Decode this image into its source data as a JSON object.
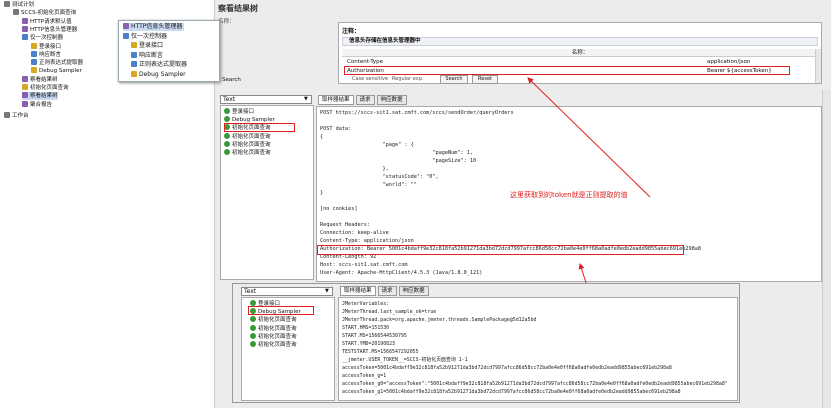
{
  "tree": {
    "items": [
      {
        "label": "测试计划",
        "indent": 0,
        "icon": "flask-icon",
        "color": "k"
      },
      {
        "label": "SCCS-初始化页面查询",
        "indent": 1,
        "icon": "gear-icon",
        "color": "k"
      },
      {
        "label": "HTTP请求默认值",
        "indent": 2,
        "icon": "wrench-icon",
        "color": "p"
      },
      {
        "label": "HTTP信息头管理器",
        "indent": 2,
        "icon": "wrench-icon",
        "color": "p"
      },
      {
        "label": "仅一次控制器",
        "indent": 2,
        "icon": "controller-icon",
        "color": "b"
      },
      {
        "label": "登录接口",
        "indent": 3,
        "icon": "pencil-icon",
        "color": "y"
      },
      {
        "label": "响应断言",
        "indent": 3,
        "icon": "magnifier-icon",
        "color": "b"
      },
      {
        "label": "正则表达式提取器",
        "indent": 3,
        "icon": "extractor-icon",
        "color": "b"
      },
      {
        "label": "Debug Sampler",
        "indent": 3,
        "icon": "pencil-icon",
        "color": "y"
      },
      {
        "label": "察看结果树",
        "indent": 2,
        "icon": "chart-icon",
        "color": "p"
      },
      {
        "label": "初始化页面查询",
        "indent": 2,
        "icon": "pencil-icon",
        "color": "y"
      },
      {
        "label": "察看结果树",
        "indent": 2,
        "icon": "chart-icon",
        "color": "p",
        "selected": true
      },
      {
        "label": "聚合报告",
        "indent": 2,
        "icon": "chart-icon",
        "color": "p"
      },
      {
        "label": "工作台",
        "indent": 0,
        "icon": "workbench-icon",
        "color": "k"
      }
    ]
  },
  "popup": {
    "items": [
      {
        "label": "HTTP信息头管理器",
        "indent": 0,
        "color": "p",
        "selected": true
      },
      {
        "label": "仅一次控制器",
        "indent": 0,
        "color": "b"
      },
      {
        "label": "登录接口",
        "indent": 1,
        "color": "y"
      },
      {
        "label": "响应断言",
        "indent": 1,
        "color": "b"
      },
      {
        "label": "正则表达式提取器",
        "indent": 1,
        "color": "b"
      },
      {
        "label": "Debug Sampler",
        "indent": 1,
        "color": "y"
      }
    ]
  },
  "main": {
    "title": "察看结果树",
    "tab_stub": "名称：",
    "comment_label": "注释：",
    "header_panel_title": "信息头存储在信息头管理器中",
    "table_header": "名称：",
    "headers": [
      {
        "name": "Content-Type",
        "value": "application/json"
      },
      {
        "name": "Authorization",
        "value": "Bearer ${accessToken}"
      }
    ],
    "search_label": "Search",
    "case_sensitive": "Case sensitive",
    "regex_label": "Regular exp.",
    "search_button": "Search",
    "reset_button": "Reset"
  },
  "top_result": {
    "renderer": "Text",
    "tabs": [
      "取样器结果",
      "请求",
      "响应数据"
    ],
    "samples": [
      {
        "label": "登录接口"
      },
      {
        "label": "Debug Sampler"
      },
      {
        "label": "初始化页面查询",
        "boxed": true
      },
      {
        "label": "初始化页面查询"
      },
      {
        "label": "初始化页面查询"
      },
      {
        "label": "初始化页面查询"
      }
    ],
    "request_text": "POST https://sccs-sit1.sat.cmft.com/sccs/sendOrder/queryOrders\n\nPOST data:\n{\n                    \"page\" : {\n                                    \"pageNum\": 1,\n                                    \"pageSize\": 10\n                    },\n                    \"statusCode\": \"0\",\n                    \"world\": \"\"\n}\n\n[no cookies]\n\nRequest Headers:\nConnection: keep-alive\nContent-Type: application/json\nAuthorization: Bearer 5001c4bdaff9e32c818fa52b91271da3bd72dcd7997afcc86d58cc72ba0e4e0ff68a0adfe0edb2eadd9855abec691eb298a8\nContent-Length: 92\nHost: sccs-sit1.sat.cmft.com\nUser-Agent: Apache-HttpClient/4.5.3 (Java/1.8.0_121)"
  },
  "bottom_result": {
    "renderer": "Text",
    "tabs": [
      "取样器结果",
      "请求",
      "响应数据"
    ],
    "samples": [
      {
        "label": "登录接口"
      },
      {
        "label": "Debug Sampler",
        "boxed": true
      },
      {
        "label": "初始化页面查询"
      },
      {
        "label": "初始化页面查询"
      },
      {
        "label": "初始化页面查询"
      },
      {
        "label": "初始化页面查询"
      }
    ],
    "debug_text": "JMeterVariables:\nJMeterThread.last_sample_ok=true\nJMeterThread.pack=org.apache.jmeter.threads.SamplePackage@5d12a5bd\nSTART.HMS=151530\nSTART.MS=1566544530795\nSTART.YMD=20190823\nTESTSTART.MS=1566547292055\n__jmeter.USER_TOKEN__=SCCS-初始化页面查询 1-1\naccessToken=5001c4bdaff9e32c818fa52b91271da3bd72dcd7997afcc86d58cc72ba0e4e0ff68a0adfe0edb2eadd9855abec691eb298a8\naccessToken_g=1\naccessToken_g0=\"accessToken\":\"5001c4bdaff9e32c818fa52b91271da3bd72dcd7997afcc86d58cc72ba0e4e0ff68a0adfe0edb2eadd9855abec691eb298a8\"\naccessToken_g1=5001c4bdaff9e32c818fa52b91271da3bd72dcd7997afcc86d58cc72ba0e4e0ff68a0adfe0edb2eadd9855abec691eb298a8"
  },
  "annotation": {
    "text": "这里获取到的token就是正则提取的值",
    "color": "#e02020"
  }
}
